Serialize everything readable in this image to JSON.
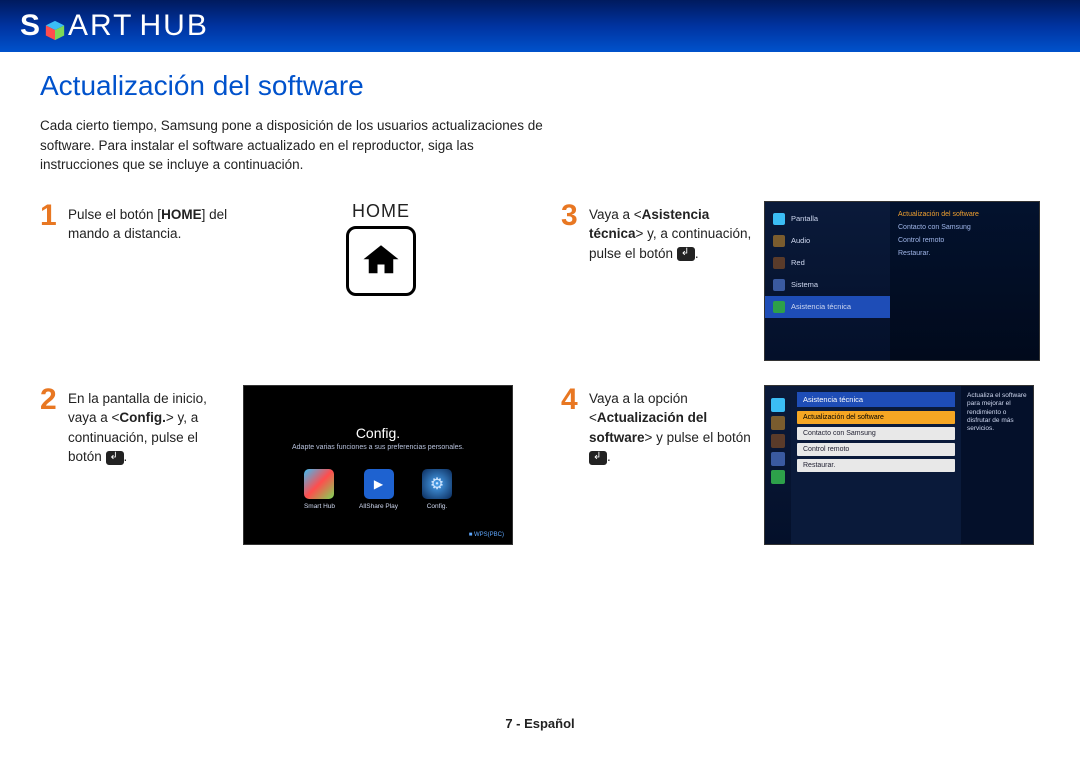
{
  "logo": {
    "s": "S",
    "art": "ART",
    "hub": "HUB"
  },
  "title": "Actualización del software",
  "intro": "Cada cierto tiempo, Samsung pone a disposición de los usuarios actualizaciones de software. Para instalar el software actualizado en el reproductor, siga las instrucciones que se incluye a continuación.",
  "steps": {
    "s1": {
      "num": "1",
      "t1": "Pulse el botón [",
      "b1": "HOME",
      "t2": "] del mando a distancia."
    },
    "s2": {
      "num": "2",
      "t1": "En la pantalla de inicio, vaya a <",
      "b1": "Config.",
      "t2": "> y, a continuación, pulse el botón ",
      "t3": "."
    },
    "s3": {
      "num": "3",
      "t1": "Vaya a <",
      "b1": "Asistencia técnica",
      "t2": "> y, a continuación, pulse el botón ",
      "t3": "."
    },
    "s4": {
      "num": "4",
      "t1": "Vaya a la opción <",
      "b1": "Actualización del software",
      "t2": "> y pulse el botón ",
      "t3": "."
    }
  },
  "home": {
    "label": "HOME"
  },
  "tv2": {
    "title": "Config.",
    "sub": "Adapte varias funciones a sus preferencias personales.",
    "icons": {
      "a": "Smart Hub",
      "b": "AllShare Play",
      "c": "Config."
    },
    "footer": "■ WPS(PBC)"
  },
  "tv3": {
    "sidebar": {
      "a": "Pantalla",
      "b": "Audio",
      "c": "Red",
      "d": "Sistema",
      "e": "Asistencia técnica"
    },
    "right": {
      "a": "Actualización del software",
      "b": "Contacto con Samsung",
      "c": "Control remoto",
      "d": "Restaurar."
    }
  },
  "tv4": {
    "panel_title": "Asistencia técnica",
    "opts": {
      "a": "Actualización del software",
      "b": "Contacto con Samsung",
      "c": "Control remoto",
      "d": "Restaurar."
    },
    "desc": "Actualiza el software para mejorar el rendimiento o disfrutar de más servicios."
  },
  "footer": "7 - Español"
}
